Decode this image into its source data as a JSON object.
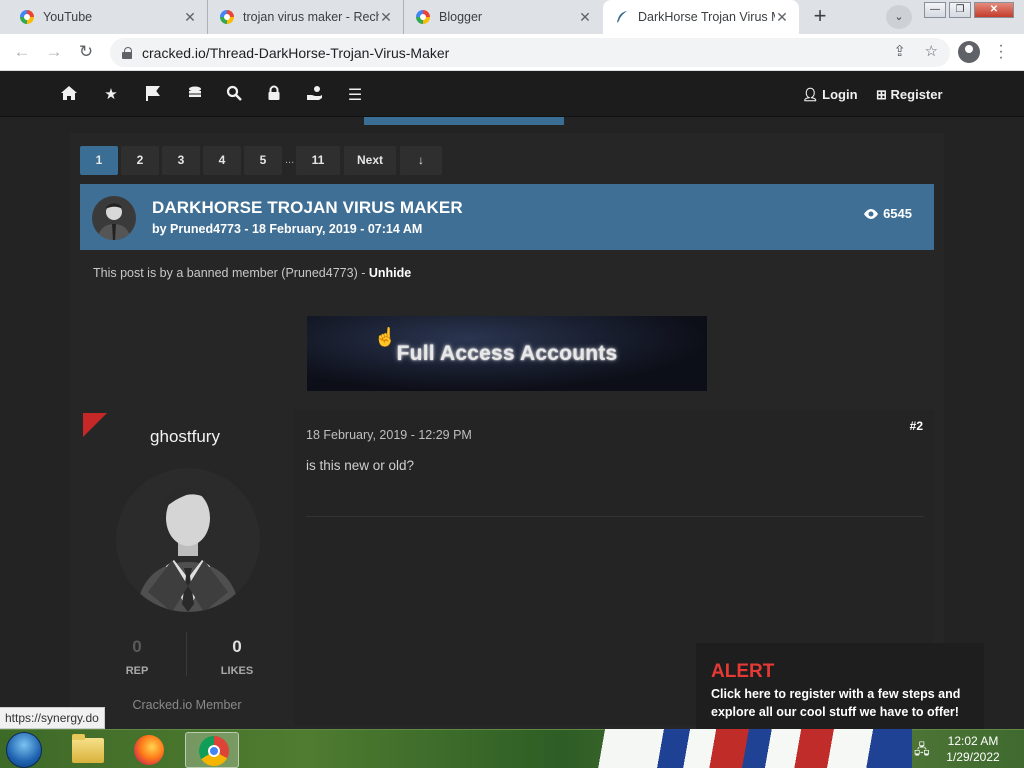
{
  "browser": {
    "tabs": [
      {
        "title": "YouTube"
      },
      {
        "title": "trojan virus maker - Rech"
      },
      {
        "title": "Blogger"
      },
      {
        "title": "DarkHorse Trojan Virus M"
      }
    ],
    "url": "cracked.io/Thread-DarkHorse-Trojan-Virus-Maker",
    "status_url": "https://synergy.do"
  },
  "site_nav": {
    "icons": [
      "home-icon",
      "star-icon",
      "flag-icon",
      "coins-icon",
      "search-icon",
      "lock-icon",
      "hand-coin-icon",
      "menu-icon"
    ],
    "login": "Login",
    "register": "Register"
  },
  "pagination": {
    "pages": [
      "1",
      "2",
      "3",
      "4",
      "5"
    ],
    "ellipsis": "...",
    "last": "11",
    "next": "Next",
    "down": "↓"
  },
  "thread": {
    "title": "DARKHORSE TROJAN VIRUS MAKER",
    "meta": "by Pruned4773 - 18 February, 2019 - 07:14 AM",
    "views": "6545"
  },
  "banned_notice": {
    "text": "This post is by a banned member (Pruned4773) - ",
    "action": "Unhide"
  },
  "banner": {
    "text": "Full Access Accounts"
  },
  "post": {
    "username": "ghostfury",
    "rep_value": "0",
    "rep_label": "REP",
    "likes_value": "0",
    "likes_label": "LIKES",
    "rank": "Cracked.io Member",
    "date": "18 February, 2019 - 12:29 PM",
    "number": "#2",
    "body": "is this new or old?"
  },
  "alert": {
    "title": "ALERT",
    "message": "Click here to register with a few steps and explore all our cool stuff we have to offer!"
  },
  "taskbar": {
    "time": "12:02 AM",
    "date": "1/29/2022"
  },
  "colors": {
    "accent_blue": "#3f6f94",
    "alert_red": "#e53935",
    "page_bg": "#232323"
  }
}
